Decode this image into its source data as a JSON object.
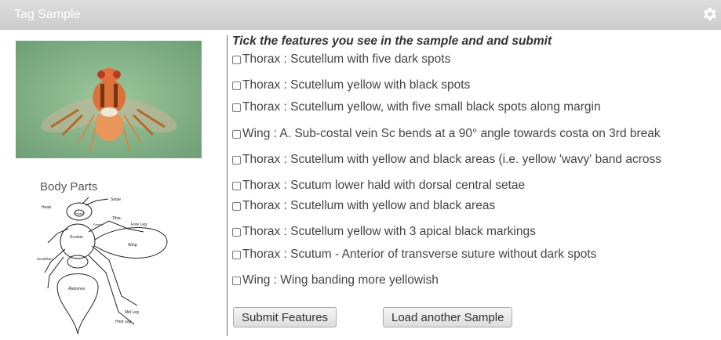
{
  "panel": {
    "title": "Tag Sample",
    "settings_icon": "gear-icon"
  },
  "left": {
    "body_parts_label": "Body Parts",
    "diagram_labels": {
      "setae": "Setae",
      "tibia": "Tibia",
      "fore_leg": "Fore Leg",
      "head": "Head",
      "head_inner": "Head",
      "femur": "Femur",
      "scutum": "Scutum",
      "scutellum": "Scutellum",
      "wing": "Wing",
      "abdomen": "Abdomen",
      "mid_leg": "Mid Leg",
      "hind_leg": "Hind Leg"
    }
  },
  "form": {
    "heading": "Tick the features you see in the sample and and submit",
    "features": [
      "Thorax : Scutellum with five dark spots",
      "Thorax : Scutellum yellow with black spots",
      "Thorax : Scutellum yellow, with five small black spots along margin",
      "Wing : A. Sub-costal vein Sc bends at a 90° angle towards costa on 3rd break",
      "Thorax : Scutellum with yellow and black areas (i.e. yellow 'wavy' band across",
      "Thorax : Scutum lower hald with dorsal central setae",
      "Thorax : Scutellum with yellow and black areas",
      "Thorax : Scutellum yellow with 3 apical black markings",
      "Thorax : Scutum - Anterior of transverse suture without dark spots",
      "Wing : Wing banding more yellowish"
    ],
    "submit_label": "Submit Features",
    "load_label": "Load another Sample"
  }
}
